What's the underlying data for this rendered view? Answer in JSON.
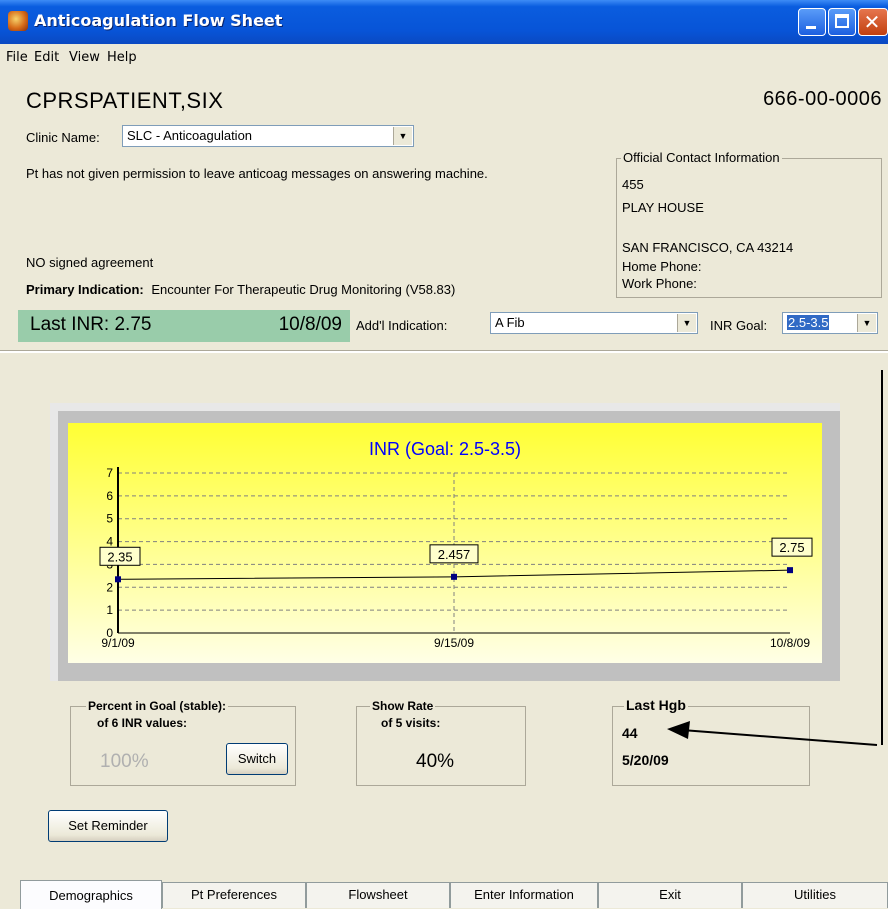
{
  "window": {
    "title": "Anticoagulation Flow Sheet"
  },
  "menu": [
    "File",
    "Edit",
    "View",
    "Help"
  ],
  "patient": {
    "name": "CPRSPATIENT,SIX",
    "ssn": "666-00-0006"
  },
  "clinic": {
    "label": "Clinic Name:",
    "value": "SLC - Anticoagulation"
  },
  "messages": {
    "permission": "Pt has not given permission to leave anticoag messages on answering machine.",
    "agreement": "NO signed agreement"
  },
  "primary_indication": {
    "label": "Primary Indication:",
    "value": "Encounter For Therapeutic Drug Monitoring (V58.83)"
  },
  "contact": {
    "legend": "Official Contact Information",
    "line1": "455",
    "line2": "PLAY HOUSE",
    "line3": "",
    "line4": "SAN FRANCISCO,  CA  43214",
    "home_phone": "Home Phone:",
    "work_phone": "Work Phone:"
  },
  "last_inr": {
    "label": "Last INR:  2.75",
    "date": "10/8/09"
  },
  "addl_indication": {
    "label": "Add'l Indication:",
    "value": "A Fib"
  },
  "inr_goal": {
    "label": "INR Goal:",
    "value": "2.5-3.5"
  },
  "chart_data": {
    "type": "line",
    "title": "INR  (Goal: 2.5-3.5)",
    "x": [
      "9/1/09",
      "9/15/09",
      "10/8/09"
    ],
    "series": [
      {
        "values": [
          2.35,
          2.457,
          2.75
        ]
      }
    ],
    "data_labels": [
      "2.35",
      "2.457",
      "2.75"
    ],
    "y_ticks": [
      "0",
      "1",
      "2",
      "3",
      "4",
      "5",
      "6",
      "7"
    ],
    "ylim": [
      0,
      7
    ],
    "grid": true,
    "background": "#ffff33"
  },
  "percent_goal": {
    "title": "Percent in Goal (stable):",
    "subtitle": "of 6 INR values:",
    "value": "100%",
    "switch": "Switch"
  },
  "show_rate": {
    "title": "Show Rate",
    "subtitle": "of 5 visits:",
    "value": "40%"
  },
  "last_hgb": {
    "title": "Last Hgb",
    "value": "44",
    "date": "5/20/09"
  },
  "reminder_button": "Set Reminder",
  "tabs": [
    "Demographics",
    "Pt Preferences",
    "Flowsheet",
    "Enter Information",
    "Exit",
    "Utilities"
  ],
  "colors": {
    "title_bar": "#0854d7",
    "inr_banner": "#99ccaa",
    "chart_bg": "#ffff33",
    "chart_title": "#0000ff"
  }
}
